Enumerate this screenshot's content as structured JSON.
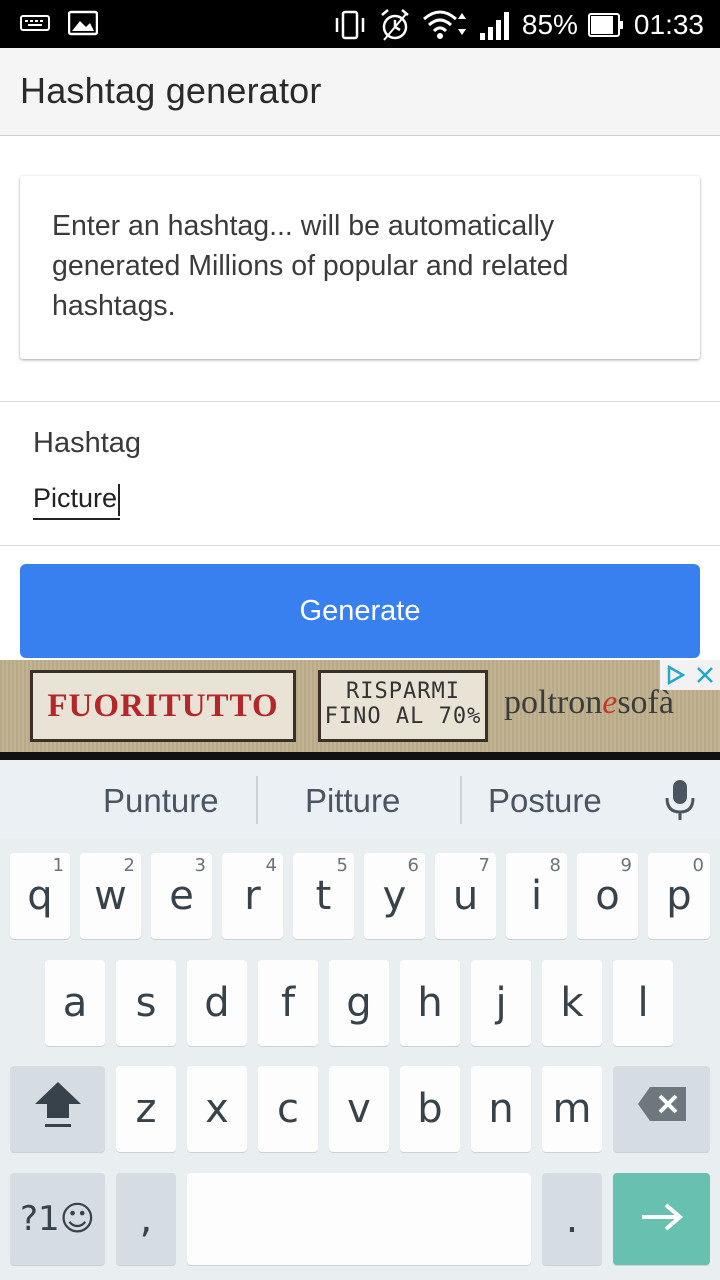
{
  "status_bar": {
    "battery": "85%",
    "time": "01:33",
    "icons": [
      "keyboard-icon",
      "image-icon",
      "vibrate-icon",
      "alarm-icon",
      "wifi-icon",
      "signal-icon",
      "battery-icon"
    ]
  },
  "app_bar": {
    "title": "Hashtag generator"
  },
  "info_card": {
    "text": "Enter an hashtag... will be automatically generated Millions of popular and related hashtags."
  },
  "hashtag_field": {
    "label": "Hashtag",
    "value": "Picture"
  },
  "generate_button": {
    "label": "Generate",
    "color": "#3880f0"
  },
  "ad": {
    "box1": "FUORITUTTO",
    "box2_line1": "RISPARMI",
    "box2_line2": "FINO AL 70%",
    "brand_pre": "poltron",
    "brand_e": "e",
    "brand_post": "sofà"
  },
  "keyboard": {
    "suggestions": [
      "Punture",
      "Pitture",
      "Posture"
    ],
    "row1": [
      {
        "k": "q",
        "h": "1"
      },
      {
        "k": "w",
        "h": "2"
      },
      {
        "k": "e",
        "h": "3"
      },
      {
        "k": "r",
        "h": "4"
      },
      {
        "k": "t",
        "h": "5"
      },
      {
        "k": "y",
        "h": "6"
      },
      {
        "k": "u",
        "h": "7"
      },
      {
        "k": "i",
        "h": "8"
      },
      {
        "k": "o",
        "h": "9"
      },
      {
        "k": "p",
        "h": "0"
      }
    ],
    "row2": [
      "a",
      "s",
      "d",
      "f",
      "g",
      "h",
      "j",
      "k",
      "l"
    ],
    "row3": [
      "z",
      "x",
      "c",
      "v",
      "b",
      "n",
      "m"
    ],
    "symbols_label": "?1☺",
    "comma": ",",
    "period": ".",
    "enter_color": "#68c0b0"
  }
}
